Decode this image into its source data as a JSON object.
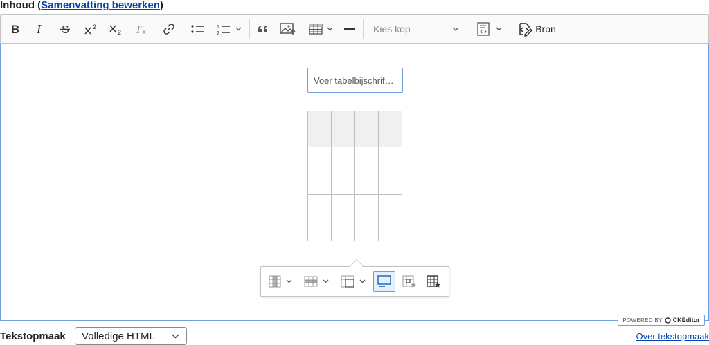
{
  "field": {
    "label_prefix": "Inhoud (",
    "summary_link": "Samenvatting bewerken",
    "label_suffix": ")"
  },
  "toolbar": {
    "heading_placeholder": "Kies kop",
    "source_label": "Bron",
    "superscript_mark": "2",
    "subscript_mark": "2",
    "buttons": [
      "bold",
      "italic",
      "strikethrough",
      "superscript",
      "subscript",
      "remove-format",
      "link",
      "bulleted-list",
      "numbered-list",
      "block-quote",
      "insert-image",
      "insert-table",
      "horizontal-line",
      "heading",
      "code-block",
      "source"
    ]
  },
  "editor": {
    "caption_placeholder": "Voer tabelbijschrif…",
    "table": {
      "columns": 4,
      "header_rows": 1,
      "rows": [
        [
          "",
          "",
          "",
          ""
        ],
        [
          "",
          "",
          "",
          ""
        ],
        [
          "",
          "",
          "",
          ""
        ]
      ]
    },
    "table_toolbar": [
      "table-column",
      "table-row",
      "merge-cells",
      "toggle-caption",
      "table-cell-properties",
      "table-properties"
    ],
    "caption_toggle_active": true,
    "powered_by": "POWERED BY",
    "brand": "CKEditor"
  },
  "footer": {
    "format_label": "Tekstopmaak",
    "format_value": "Volledige HTML",
    "about_link": "Over tekstopmaak"
  },
  "colors": {
    "focus_blue": "#6f9fe0",
    "link_blue": "#0645ad",
    "header_cell": "#f0f0f0"
  }
}
